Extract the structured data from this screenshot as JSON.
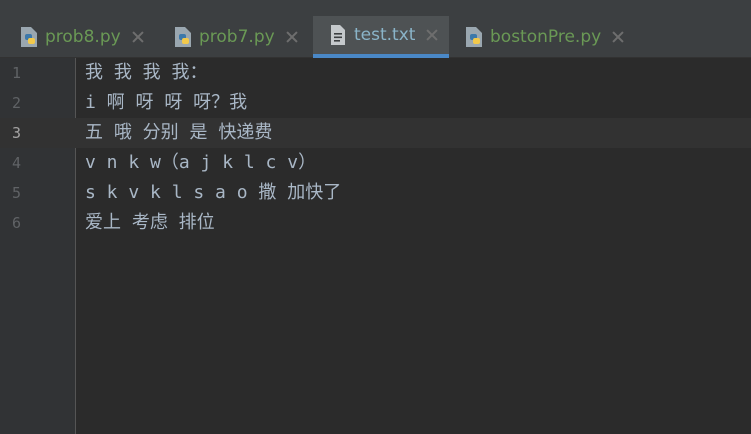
{
  "tabs": [
    {
      "label": "prob8.py",
      "icon": "python-file-icon",
      "active": false
    },
    {
      "label": "prob7.py",
      "icon": "python-file-icon",
      "active": false
    },
    {
      "label": "test.txt",
      "icon": "text-file-icon",
      "active": true
    },
    {
      "label": "bostonPre.py",
      "icon": "python-file-icon",
      "active": false
    }
  ],
  "editor": {
    "current_line": 3,
    "lines": [
      {
        "number": "1",
        "text": "我 我 我 我："
      },
      {
        "number": "2",
        "text": "i 啊 呀 呀 呀？我"
      },
      {
        "number": "3",
        "text": "五 哦 分别 是 快递费"
      },
      {
        "number": "4",
        "text": "v n k w（a j k l c v）"
      },
      {
        "number": "5",
        "text": "s k v k l s a o 撒 加快了"
      },
      {
        "number": "6",
        "text": "爱上 考虑 排位"
      }
    ]
  },
  "colors": {
    "background": "#2b2b2b",
    "tab_bar": "#3c3f41",
    "active_tab_underline": "#4a88c7",
    "text": "#a9b7c6",
    "line_number": "#606366"
  }
}
